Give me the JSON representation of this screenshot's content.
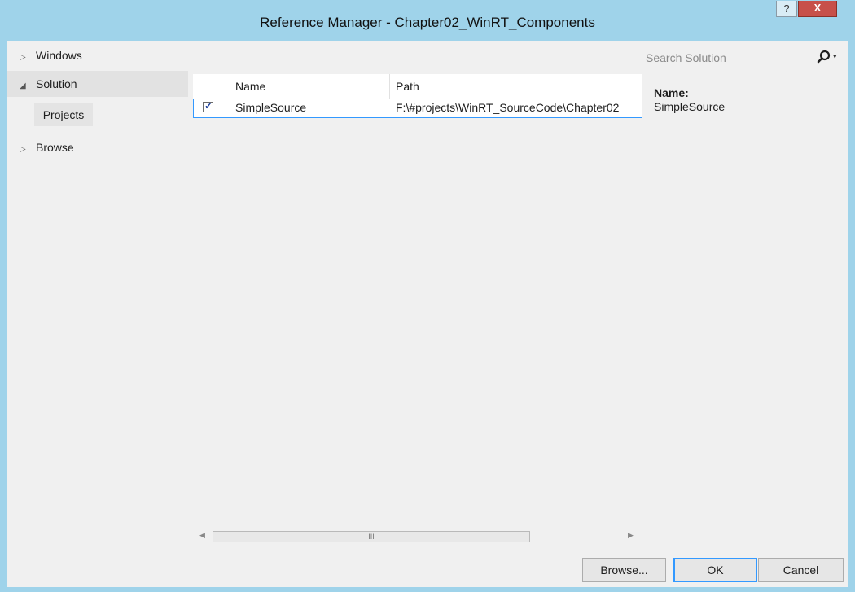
{
  "window": {
    "title": "Reference Manager - Chapter02_WinRT_Components",
    "help_label": "?",
    "close_label": "X"
  },
  "nav": {
    "items": [
      {
        "label": "Windows",
        "arrow": "▷"
      },
      {
        "label": "Solution",
        "arrow": "◢"
      },
      {
        "label": "Browse",
        "arrow": "▷"
      }
    ],
    "sub_item": "Projects"
  },
  "list": {
    "columns": [
      "Name",
      "Path"
    ],
    "rows": [
      {
        "checked": true,
        "name": "SimpleSource",
        "path": "F:\\#projects\\WinRT_SourceCode\\Chapter02"
      }
    ]
  },
  "scrollbar": {
    "left_arrow": "◀",
    "right_arrow": "▶",
    "thumb_grip": "III"
  },
  "search": {
    "placeholder": "Search Solution",
    "icon": "search-icon",
    "dropdown_arrow": "▾"
  },
  "details": {
    "label": "Name:",
    "value": "SimpleSource"
  },
  "buttons": {
    "browse": "Browse...",
    "ok": "OK",
    "cancel": "Cancel"
  },
  "colors": {
    "title_bar": "#9fd3ea",
    "close_button": "#c7504a",
    "selection_border": "#3399ff",
    "client_bg": "#f0f0f0"
  }
}
